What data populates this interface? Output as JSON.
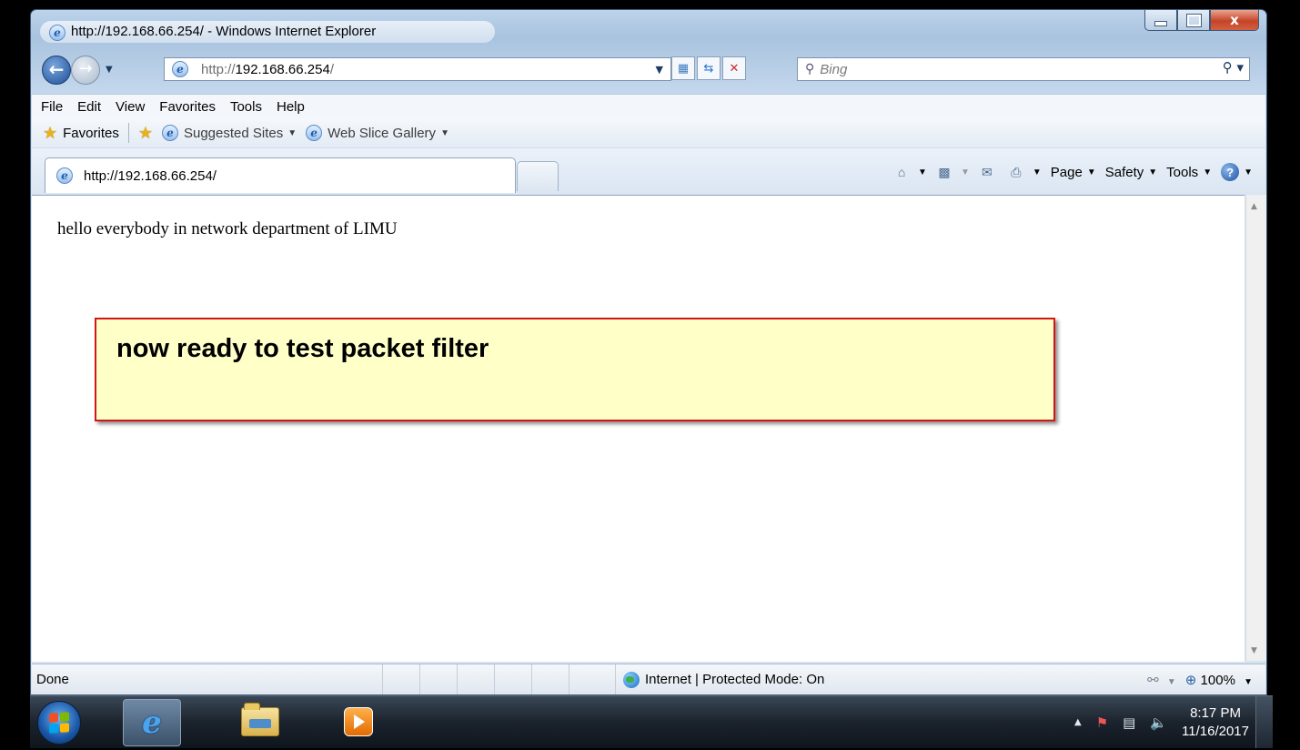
{
  "window": {
    "title": "http://192.168.66.254/ - Windows Internet Explorer",
    "close_glyph": "x"
  },
  "address_bar": {
    "scheme": "http://",
    "host": "192.168.66.254",
    "path": "/"
  },
  "search": {
    "placeholder": "Bing"
  },
  "menu": [
    "File",
    "Edit",
    "View",
    "Favorites",
    "Tools",
    "Help"
  ],
  "favorites_bar": {
    "favorites_label": "Favorites",
    "suggested_sites": "Suggested Sites",
    "web_slice_gallery": "Web Slice Gallery"
  },
  "tab": {
    "label": "http://192.168.66.254/"
  },
  "command_bar": {
    "page": "Page",
    "safety": "Safety",
    "tools": "Tools"
  },
  "page": {
    "text": "hello everybody in network department of LIMU",
    "callout": "now ready to test packet filter"
  },
  "status_bar": {
    "status": "Done",
    "zone": "Internet | Protected Mode: On",
    "zoom": "100%"
  },
  "taskbar": {
    "time": "8:17 PM",
    "date": "11/16/2017"
  },
  "colors": {
    "callout_fill": "#ffffc8",
    "callout_border": "#d31515"
  }
}
